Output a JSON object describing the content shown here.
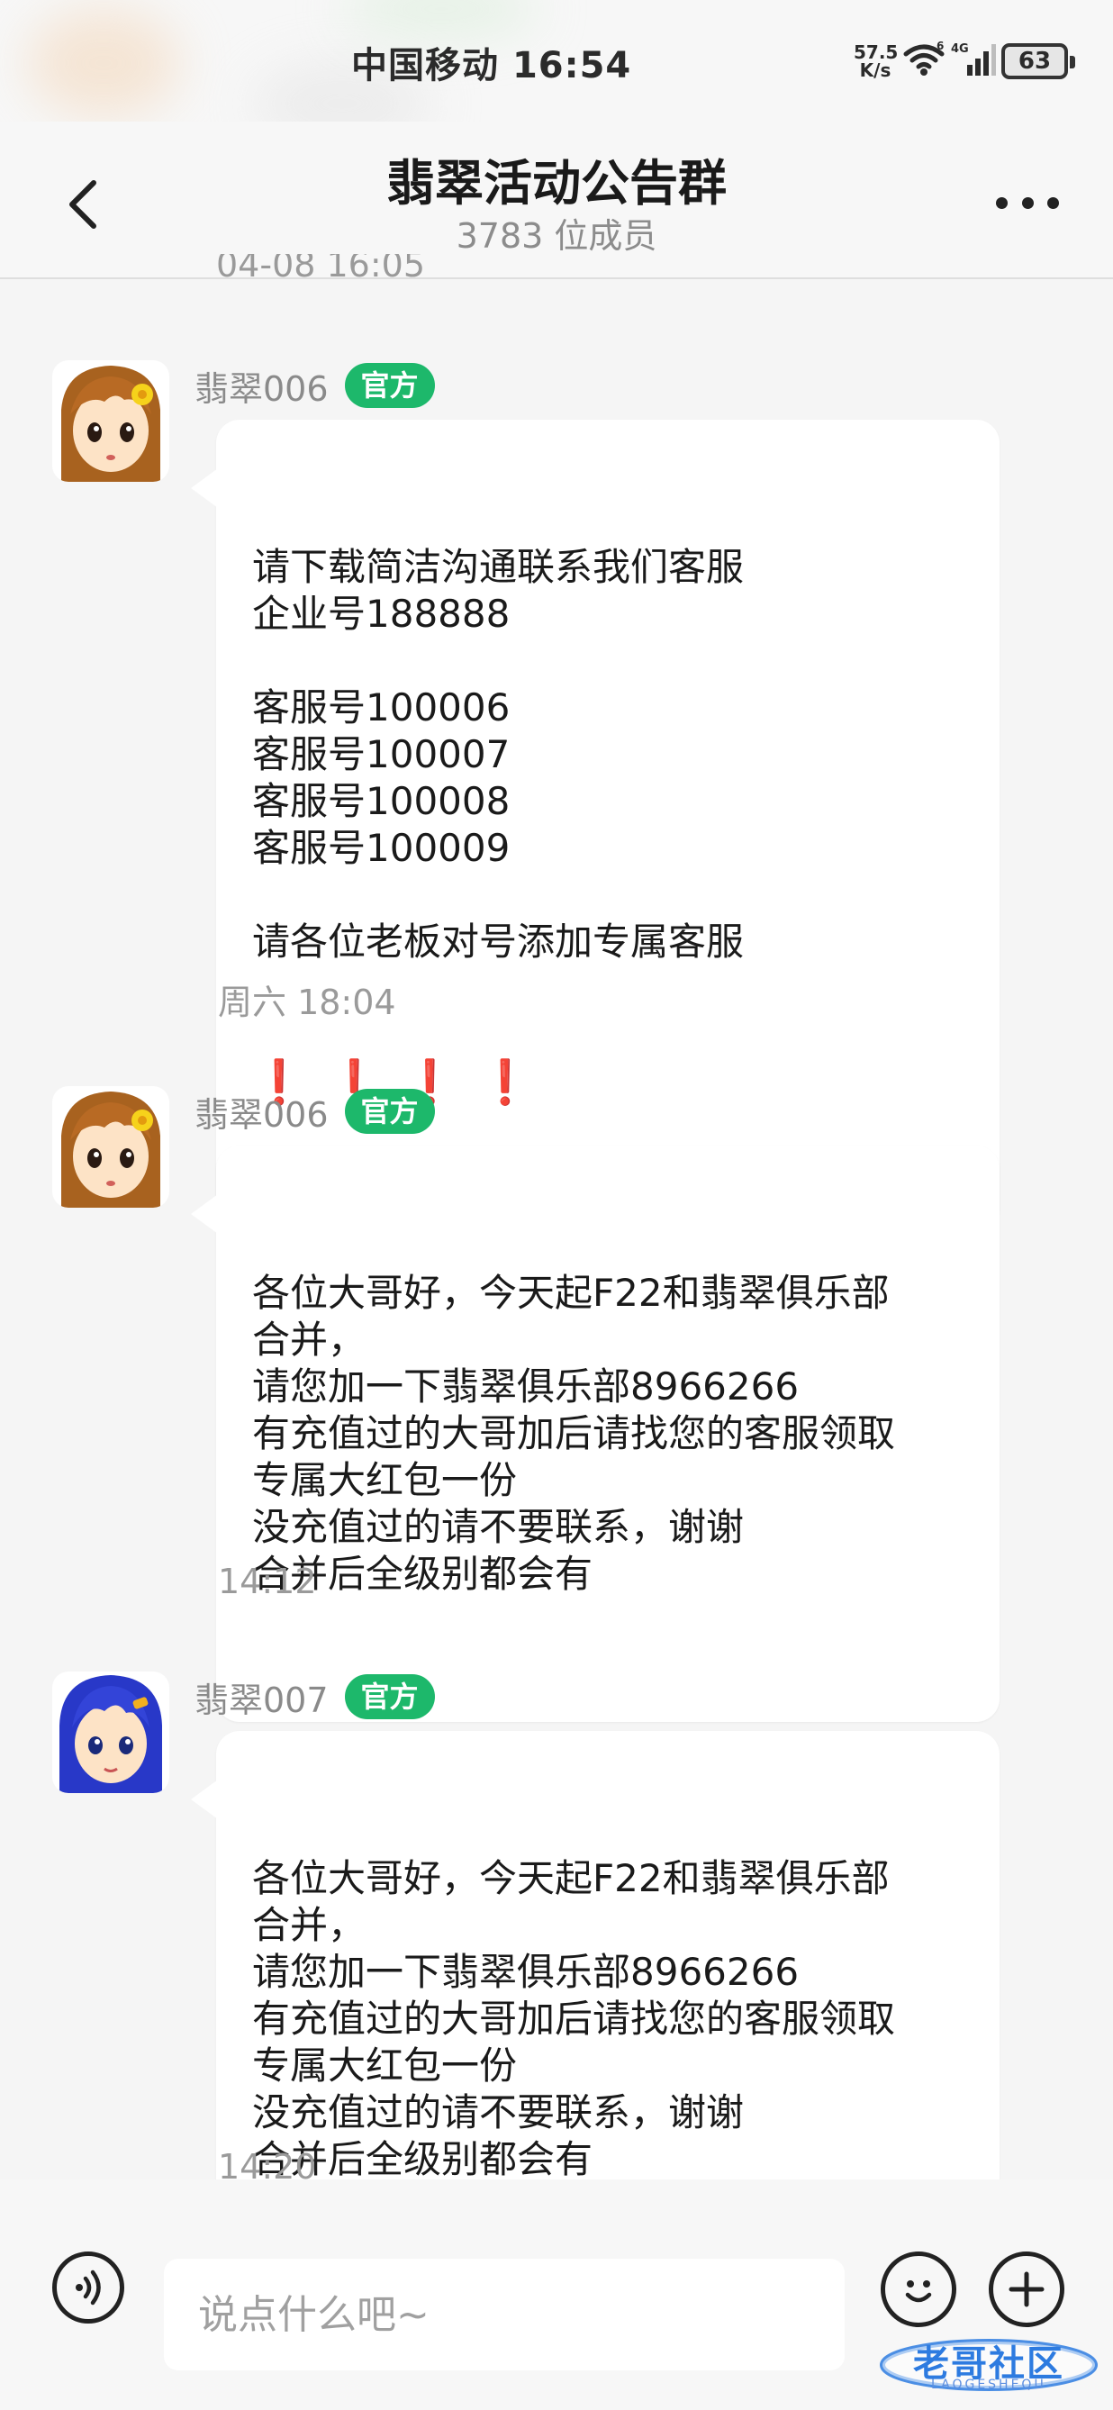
{
  "status_bar": {
    "carrier": "中国移动",
    "time": "16:54",
    "net_speed_value": "57.5",
    "net_speed_unit": "K/s",
    "battery": "63",
    "network_type": "4G"
  },
  "header": {
    "title": "翡翠活动公告群",
    "member_count": "3783 位成员"
  },
  "cut_timestamp": "04-08 16:05",
  "messages": [
    {
      "sender": "翡翠006",
      "badge": "官方",
      "text": "请下载简洁沟通联系我们客服\n企业号188888\n\n客服号100006\n客服号100007\n客服号100008\n客服号100009\n\n请各位老板对号添加专属客服",
      "emphasis": "❗❗❗❗",
      "time": "周六 18:04"
    },
    {
      "sender": "翡翠006",
      "badge": "官方",
      "text": "各位大哥好，今天起F22和翡翠俱乐部\n合并，\n请您加一下翡翠俱乐部8966266\n有充值过的大哥加后请找您的客服领取\n专属大红包一份\n没充值过的请不要联系，谢谢\n合并后全级别都会有",
      "time": "14:12"
    },
    {
      "sender": "翡翠007",
      "badge": "官方",
      "text": "各位大哥好，今天起F22和翡翠俱乐部\n合并，\n请您加一下翡翠俱乐部8966266\n有充值过的大哥加后请找您的客服领取\n专属大红包一份\n没充值过的请不要联系，谢谢\n合并后全级别都会有",
      "time": "14:20"
    }
  ],
  "input_bar": {
    "placeholder": "说点什么吧~"
  },
  "watermark": {
    "text": "老哥社区",
    "sub": "LAOGESHEQU"
  },
  "colors": {
    "official_badge": "#1db86b",
    "exclamation": "#d7262b",
    "background": "#f5f5f5",
    "bubble": "#ffffff"
  }
}
